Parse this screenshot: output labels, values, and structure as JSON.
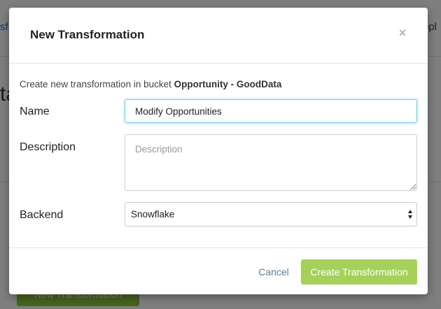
{
  "background": {
    "nav_left_fragment": "sf",
    "nav_right_fragment": "opl",
    "heading_fragment": "ta",
    "button_label": "New Transformation"
  },
  "modal": {
    "title": "New Transformation",
    "close_glyph": "×",
    "intro_text": "Create new transformation in bucket ",
    "bucket_name": "Opportunity - GoodData",
    "fields": {
      "name_label": "Name",
      "name_value": "Modify Opportunities",
      "description_label": "Description",
      "description_placeholder": "Description",
      "backend_label": "Backend",
      "backend_value": "Snowflake"
    },
    "footer": {
      "cancel_label": "Cancel",
      "create_label": "Create Transformation"
    }
  },
  "colors": {
    "primary_button": "#a5d15a",
    "focus_border": "#6ccfe6",
    "link_text": "#5b7a99"
  },
  "icons": {
    "close": "close-icon",
    "select_arrows": "select-arrows-icon"
  }
}
